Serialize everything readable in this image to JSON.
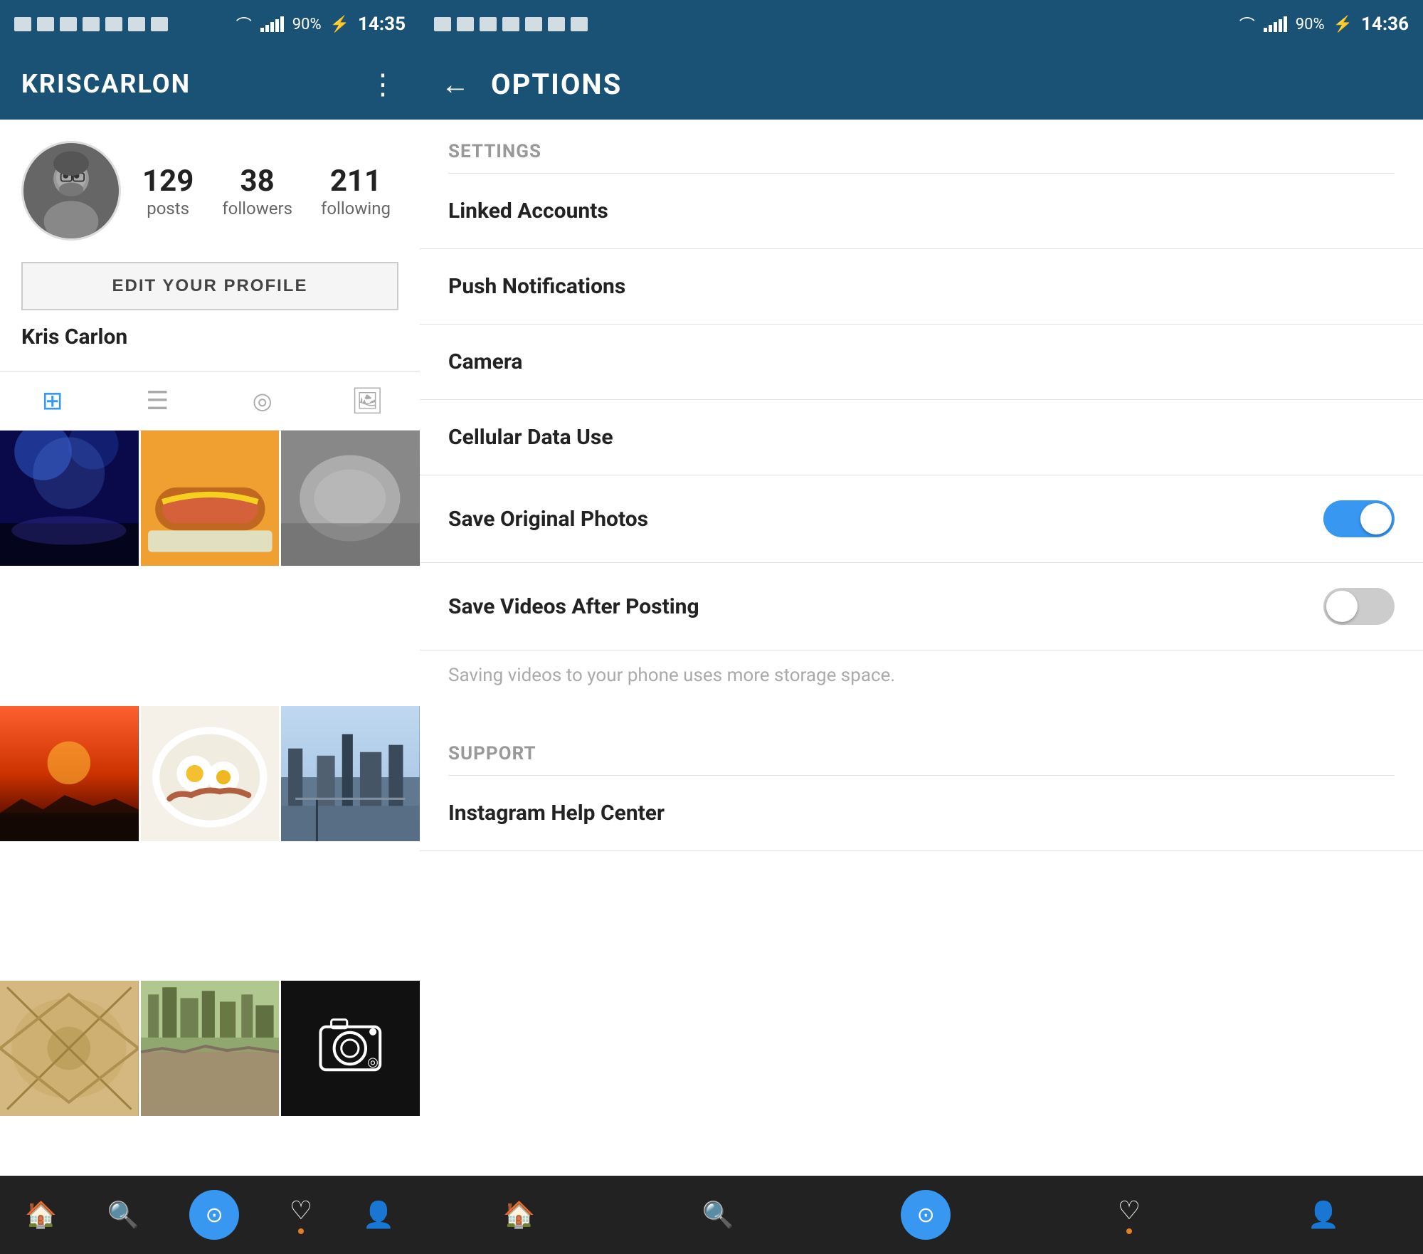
{
  "left": {
    "statusBar": {
      "time": "14:35",
      "battery": "90%"
    },
    "header": {
      "title": "KRISCARLON",
      "menuIcon": "⋮"
    },
    "profile": {
      "name": "Kris Carlon",
      "stats": [
        {
          "number": "129",
          "label": "posts"
        },
        {
          "number": "38",
          "label": "followers"
        },
        {
          "number": "211",
          "label": "following"
        }
      ],
      "editButton": "EDIT YOUR PROFILE"
    },
    "tabs": [
      {
        "icon": "⊞",
        "active": true,
        "name": "grid-view"
      },
      {
        "icon": "☰",
        "active": false,
        "name": "list-view"
      },
      {
        "icon": "◎",
        "active": false,
        "name": "map-view"
      },
      {
        "icon": "👤",
        "active": false,
        "name": "tagged-view"
      }
    ],
    "photos": [
      {
        "id": 1,
        "class": "photo-1"
      },
      {
        "id": 2,
        "class": "photo-2"
      },
      {
        "id": 3,
        "class": "photo-3"
      },
      {
        "id": 4,
        "class": "photo-4"
      },
      {
        "id": 5,
        "class": "photo-5"
      },
      {
        "id": 6,
        "class": "photo-6"
      },
      {
        "id": 7,
        "class": "photo-7"
      },
      {
        "id": 8,
        "class": "photo-8"
      },
      {
        "id": 9,
        "class": "photo-9"
      }
    ],
    "bottomNav": [
      {
        "icon": "🏠",
        "name": "home-nav",
        "active": false,
        "dot": false
      },
      {
        "icon": "🔍",
        "name": "search-nav",
        "active": false,
        "dot": false
      },
      {
        "icon": "⊙",
        "name": "camera-nav",
        "active": true,
        "dot": false
      },
      {
        "icon": "♡",
        "name": "likes-nav",
        "active": false,
        "dot": true
      },
      {
        "icon": "👤",
        "name": "profile-nav",
        "active": false,
        "dot": false
      }
    ]
  },
  "right": {
    "statusBar": {
      "time": "14:36",
      "battery": "90%"
    },
    "header": {
      "backIcon": "←",
      "title": "OPTIONS"
    },
    "settings": {
      "sectionHeader": "SETTINGS",
      "items": [
        {
          "label": "Linked Accounts",
          "type": "link",
          "name": "linked-accounts"
        },
        {
          "label": "Push Notifications",
          "type": "link",
          "name": "push-notifications"
        },
        {
          "label": "Camera",
          "type": "link",
          "name": "camera"
        },
        {
          "label": "Cellular Data Use",
          "type": "link",
          "name": "cellular-data"
        },
        {
          "label": "Save Original Photos",
          "type": "toggle",
          "name": "save-photos",
          "on": true
        },
        {
          "label": "Save Videos After Posting",
          "type": "toggle",
          "name": "save-videos",
          "on": false
        },
        {
          "sublabel": "Saving videos to your phone uses more storage space.",
          "type": "info",
          "name": "videos-info"
        }
      ]
    },
    "support": {
      "sectionHeader": "SUPPORT",
      "items": [
        {
          "label": "Instagram Help Center",
          "type": "link",
          "name": "help-center"
        }
      ]
    },
    "bottomNav": [
      {
        "icon": "🏠",
        "name": "home-nav-right",
        "active": false,
        "dot": false
      },
      {
        "icon": "🔍",
        "name": "search-nav-right",
        "active": false,
        "dot": false
      },
      {
        "icon": "⊙",
        "name": "camera-nav-right",
        "active": true,
        "dot": false
      },
      {
        "icon": "♡",
        "name": "likes-nav-right",
        "active": false,
        "dot": true
      },
      {
        "icon": "👤",
        "name": "profile-nav-right",
        "active": false,
        "dot": false
      }
    ]
  }
}
